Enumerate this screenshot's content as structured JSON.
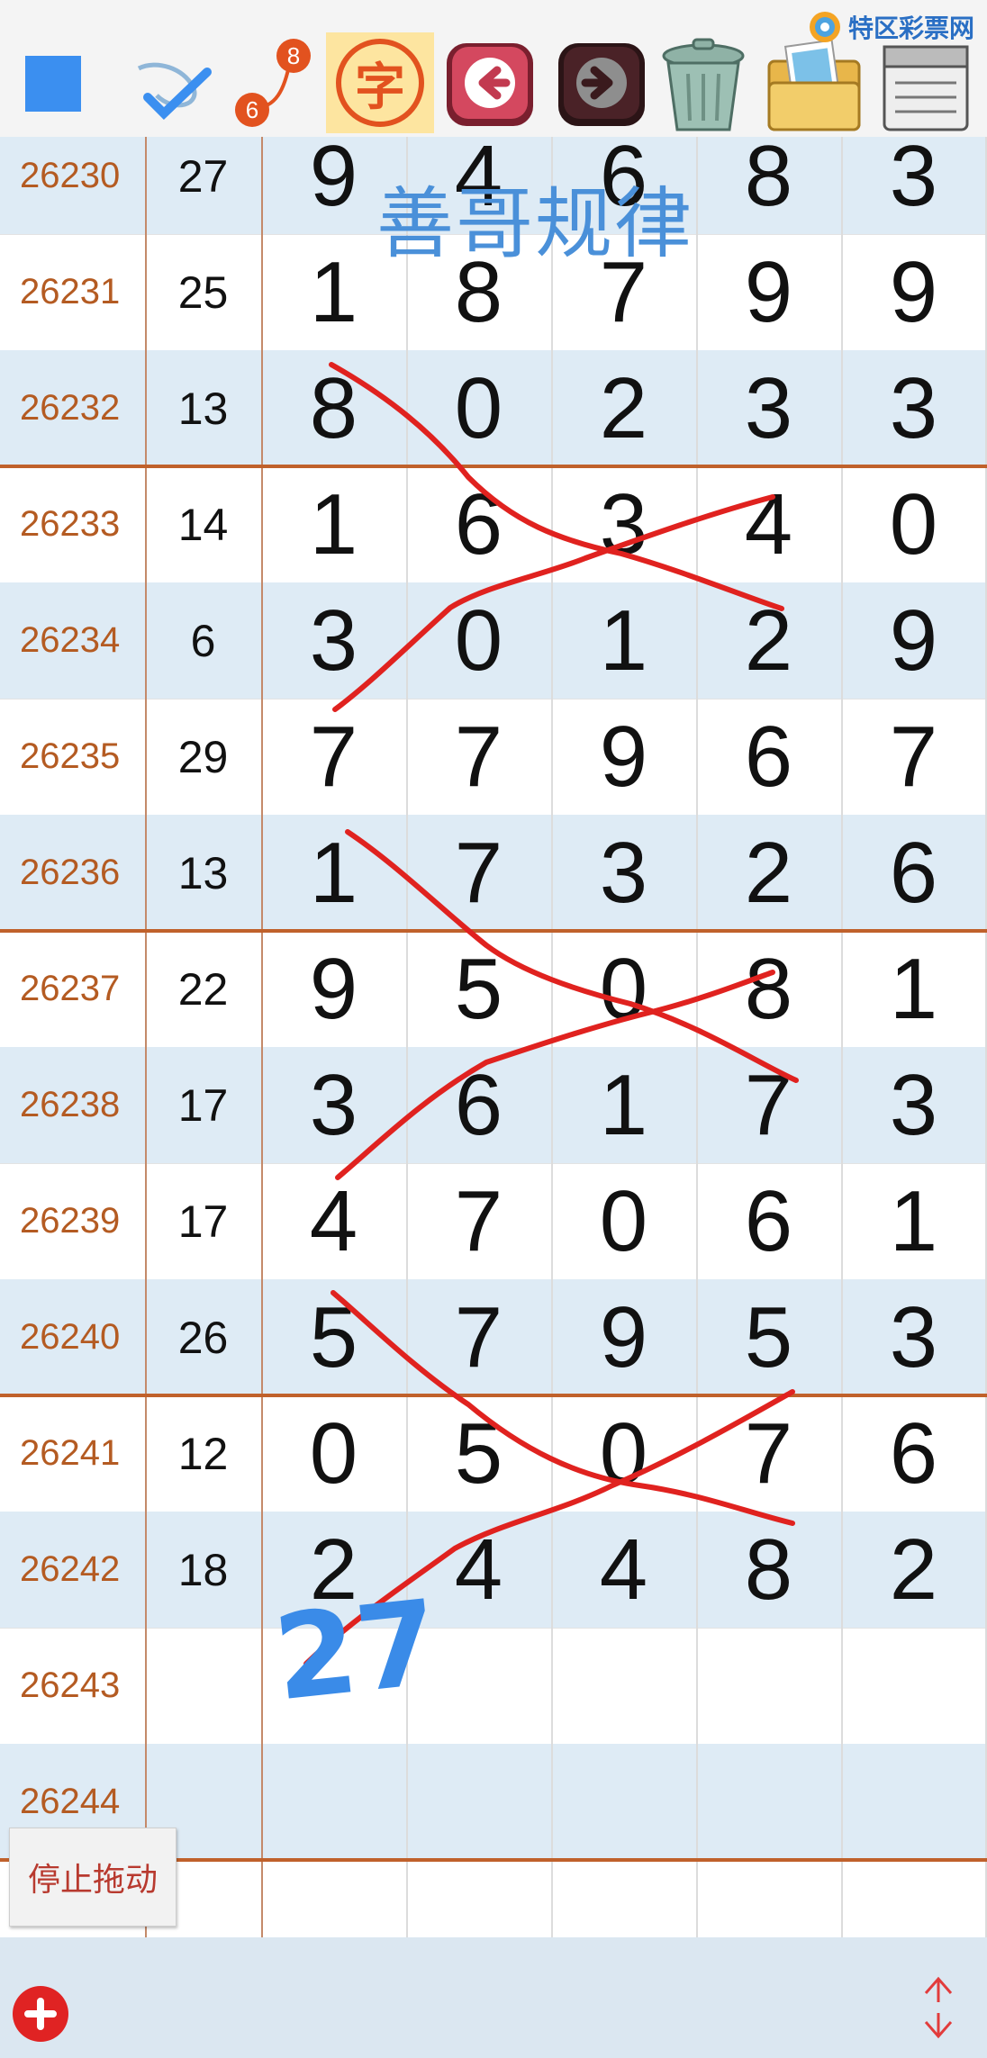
{
  "toolbar": {
    "icons": [
      "square-color-icon",
      "pen-check-icon",
      "number-path-icon",
      "zi-char-icon",
      "back-arrow-icon",
      "forward-arrow-icon",
      "trash-can-icon",
      "photo-folder-icon",
      "notepad-icon"
    ],
    "zi_char": "字",
    "path_numbers": {
      "top": "8",
      "bottom": "6"
    },
    "site_name": "特区彩票网",
    "accent": "#3b8ff0"
  },
  "watermark": "善哥规律",
  "rows": [
    {
      "issue": "26230",
      "sum": "27",
      "digits": [
        "9",
        "4",
        "6",
        "8",
        "3"
      ]
    },
    {
      "issue": "26231",
      "sum": "25",
      "digits": [
        "1",
        "8",
        "7",
        "9",
        "9"
      ]
    },
    {
      "issue": "26232",
      "sum": "13",
      "digits": [
        "8",
        "0",
        "2",
        "3",
        "3"
      ]
    },
    {
      "issue": "26233",
      "sum": "14",
      "digits": [
        "1",
        "6",
        "3",
        "4",
        "0"
      ]
    },
    {
      "issue": "26234",
      "sum": "6",
      "digits": [
        "3",
        "0",
        "1",
        "2",
        "9"
      ]
    },
    {
      "issue": "26235",
      "sum": "29",
      "digits": [
        "7",
        "7",
        "9",
        "6",
        "7"
      ]
    },
    {
      "issue": "26236",
      "sum": "13",
      "digits": [
        "1",
        "7",
        "3",
        "2",
        "6"
      ]
    },
    {
      "issue": "26237",
      "sum": "22",
      "digits": [
        "9",
        "5",
        "0",
        "8",
        "1"
      ]
    },
    {
      "issue": "26238",
      "sum": "17",
      "digits": [
        "3",
        "6",
        "1",
        "7",
        "3"
      ]
    },
    {
      "issue": "26239",
      "sum": "17",
      "digits": [
        "4",
        "7",
        "0",
        "6",
        "1"
      ]
    },
    {
      "issue": "26240",
      "sum": "26",
      "digits": [
        "5",
        "7",
        "9",
        "5",
        "3"
      ]
    },
    {
      "issue": "26241",
      "sum": "12",
      "digits": [
        "0",
        "5",
        "0",
        "7",
        "6"
      ]
    },
    {
      "issue": "26242",
      "sum": "18",
      "digits": [
        "2",
        "4",
        "4",
        "8",
        "2"
      ]
    },
    {
      "issue": "26243",
      "sum": "",
      "digits": [
        "",
        "",
        "",
        "",
        ""
      ]
    },
    {
      "issue": "26244",
      "sum": "",
      "digits": [
        "",
        "",
        "",
        "",
        ""
      ]
    },
    {
      "issue": "",
      "sum": "",
      "digits": [
        "",
        "",
        "",
        "",
        ""
      ]
    }
  ],
  "handwritten_note": "27",
  "stop_drag_label": "停止拖动",
  "bottom": {
    "add_icon": "plus-circle-icon",
    "scroll_icon": "up-down-arrows-icon"
  },
  "colors": {
    "issue_text": "#b45b22",
    "row_alt": "#deebf5",
    "group_line": "#c0612b",
    "stroke": "#e0221f",
    "note": "#3a8be8"
  }
}
